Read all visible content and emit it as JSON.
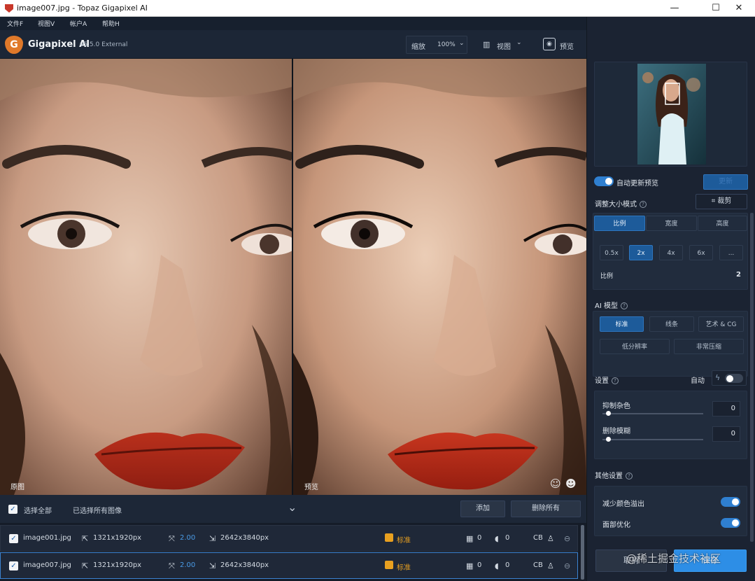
{
  "window": {
    "title": "image007.jpg - Topaz Gigapixel AI",
    "minimize": "—",
    "maximize": "☐",
    "close": "✕"
  },
  "menu": [
    "文件F",
    "视图V",
    "帐户A",
    "帮助H"
  ],
  "app": {
    "name": "Gigapixel AI",
    "version": "v5.5.0 External",
    "logo_letter": "G"
  },
  "toolbar": {
    "zoom_label": "缩放",
    "zoom_value": "100%",
    "view_label": "视图",
    "preview_label": "预览"
  },
  "canvas": {
    "left_label": "原图",
    "right_label": "预览"
  },
  "filebar": {
    "select_all": "选择全部",
    "selected_text": "已选择所有图像",
    "add": "添加",
    "remove_all": "删除所有"
  },
  "files": [
    {
      "name": "image001.jpg",
      "input_size": "1321x1920px",
      "scale": "2.00",
      "output_size": "2642x3840px",
      "model": "标准",
      "noise": "0",
      "blur": "0",
      "face": "CB"
    },
    {
      "name": "image007.jpg",
      "input_size": "1321x1920px",
      "scale": "2.00",
      "output_size": "2642x3840px",
      "model": "标准",
      "noise": "0",
      "blur": "0",
      "face": "CB"
    }
  ],
  "panel": {
    "auto_preview": "自动更新预览",
    "update_btn": "更新",
    "resize_title": "调整大小模式",
    "crop": "裁剪",
    "resize_tabs": [
      "比例",
      "宽度",
      "高度"
    ],
    "scale_opts": [
      "0.5x",
      "2x",
      "4x",
      "6x",
      "..."
    ],
    "scale_label": "比例",
    "scale_value": "2",
    "ai_title": "AI 模型",
    "models": [
      "标准",
      "线条",
      "艺术 & CG",
      "低分辨率",
      "非常压缩"
    ],
    "settings_title": "设置",
    "auto": "自动",
    "noise_label": "抑制杂色",
    "noise_value": "0",
    "blur_label": "删除模糊",
    "blur_value": "0",
    "other_title": "其他设置",
    "color_bleed": "减少颜色溢出",
    "face": "面部优化",
    "cancel": "取消",
    "save": "保存",
    "watermark": "@稀土掘金技术社区"
  },
  "colors": {
    "accent": "#2f7fd0",
    "active_seg": "#1d5b9a",
    "model_tag": "#e8a020"
  }
}
